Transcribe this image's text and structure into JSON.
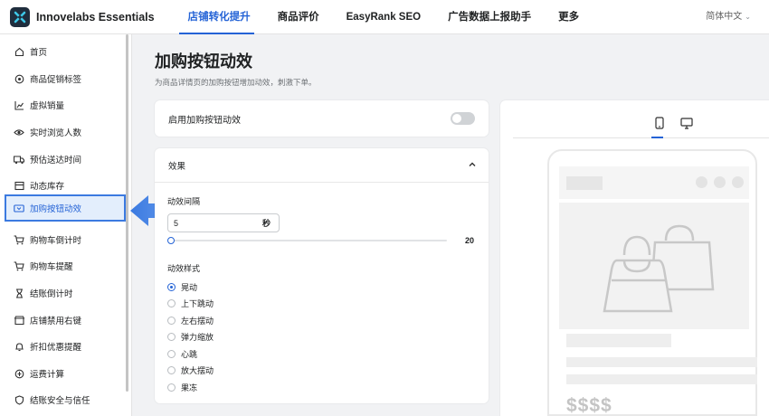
{
  "app": {
    "name": "Innovelabs Essentials"
  },
  "nav": {
    "items": [
      "店铺转化提升",
      "商品评价",
      "EasyRank SEO",
      "广告数据上报助手",
      "更多"
    ],
    "active_index": 0
  },
  "language": {
    "label": "简体中文"
  },
  "sidebar": {
    "items": [
      {
        "label": "首页",
        "icon": "home-icon"
      },
      {
        "label": "商品促销标签",
        "icon": "badge-icon"
      },
      {
        "label": "虚拟销量",
        "icon": "chart-icon"
      },
      {
        "label": "实时浏览人数",
        "icon": "eye-icon"
      },
      {
        "label": "预估送达时间",
        "icon": "truck-icon"
      },
      {
        "label": "动态库存",
        "icon": "inventory-icon"
      },
      {
        "label": "加购按钮动效",
        "icon": "cart-button-icon"
      },
      {
        "label": "购物车倒计时",
        "icon": "cart-icon"
      },
      {
        "label": "购物车提醒",
        "icon": "cart-icon"
      },
      {
        "label": "结账倒计时",
        "icon": "hourglass-icon"
      },
      {
        "label": "店铺禁用右键",
        "icon": "mouse-icon"
      },
      {
        "label": "折扣优惠提醒",
        "icon": "bell-icon"
      },
      {
        "label": "运费计算",
        "icon": "calculator-icon"
      },
      {
        "label": "结账安全与信任",
        "icon": "shield-icon"
      }
    ],
    "active_index": 6
  },
  "page": {
    "title": "加购按钮动效",
    "subtitle": "为商品详情页的加购按钮增加动效，刺激下单。"
  },
  "enable": {
    "label": "启用加购按钮动效",
    "enabled": false
  },
  "effect": {
    "section_title": "效果",
    "interval_label": "动效间隔",
    "interval_value": "5",
    "interval_unit": "秒",
    "slider_max": "20",
    "slider_value": 5,
    "style_label": "动效样式",
    "options": [
      "晃动",
      "上下跳动",
      "左右摆动",
      "弹力缩放",
      "心跳",
      "放大摆动",
      "果冻"
    ],
    "selected_index": 0
  },
  "preview": {
    "price_placeholder": "$$$$",
    "device_active": "mobile"
  },
  "colors": {
    "accent": "#2463d6",
    "highlight_border": "#3b7ae0",
    "highlight_bg": "#e3eefc"
  }
}
